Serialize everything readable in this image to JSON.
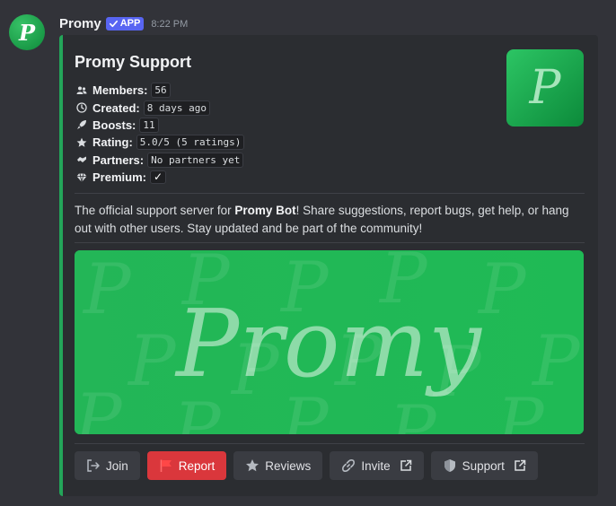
{
  "message": {
    "author": "Promy",
    "badge": "APP",
    "timestamp": "8:22 PM",
    "avatar_letter": "P"
  },
  "embed": {
    "accent_color": "#23a559",
    "title": "Promy Support",
    "thumbnail_letter": "P",
    "fields": [
      {
        "icon": "members-icon",
        "label": "Members:",
        "value": "56"
      },
      {
        "icon": "clock-icon",
        "label": "Created:",
        "value": "8 days ago"
      },
      {
        "icon": "rocket-icon",
        "label": "Boosts:",
        "value": "11"
      },
      {
        "icon": "star-icon",
        "label": "Rating:",
        "value": "5.0/5 (5 ratings)"
      },
      {
        "icon": "handshake-icon",
        "label": "Partners:",
        "value": "No partners yet"
      },
      {
        "icon": "diamond-icon",
        "label": "Premium:",
        "value": "✓"
      }
    ],
    "description": {
      "before": "The official support server for ",
      "bold": "Promy Bot",
      "after": "! Share suggestions, report bugs, get help, or hang out with other users. Stay updated and be part of the community!"
    },
    "banner_text": "Promy",
    "banner_color": "#22b85a"
  },
  "buttons": [
    {
      "label": "Join",
      "icon": "join-icon",
      "style": "secondary"
    },
    {
      "label": "Report",
      "icon": "flag-icon",
      "style": "danger",
      "color": "#da373c"
    },
    {
      "label": "Reviews",
      "icon": "star-icon",
      "style": "secondary"
    },
    {
      "label": "Invite",
      "icon": "link-icon",
      "style": "secondary",
      "external": true
    },
    {
      "label": "Support",
      "icon": "shield-icon",
      "style": "secondary",
      "external": true
    }
  ]
}
